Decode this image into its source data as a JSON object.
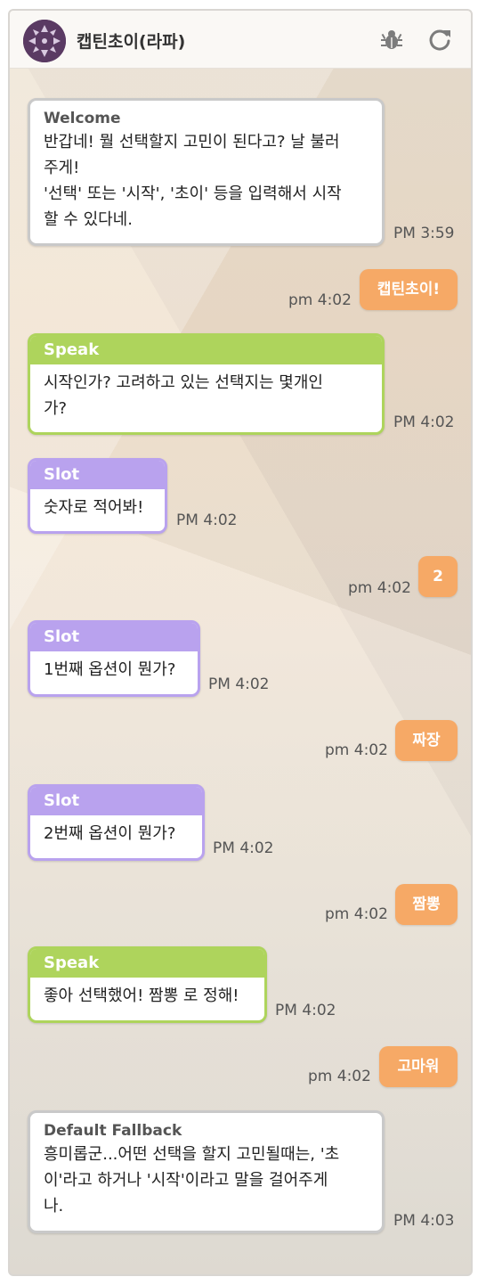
{
  "header": {
    "title": "캡틴초이(라파)",
    "icons": [
      "avatar",
      "bug-icon",
      "reload-icon"
    ]
  },
  "messages": [
    {
      "type": "bot",
      "kind": "Welcome",
      "head": "Welcome",
      "lines": [
        "반갑네! 뭘 선택할지 고민이 된다고? 날 불러",
        "주게!",
        "'선택' 또는 '시작', '초이' 등을 입력해서 시작",
        "할 수 있다네."
      ],
      "time": "PM 3:59"
    },
    {
      "type": "user",
      "text": "캡틴초이!",
      "time": "pm 4:02"
    },
    {
      "type": "bot",
      "kind": "Speak",
      "head": "Speak",
      "lines": [
        "시작인가? 고려하고 있는 선택지는 몇개인",
        "가?"
      ],
      "time": "PM 4:02"
    },
    {
      "type": "bot",
      "kind": "Slot",
      "head": "Slot",
      "lines": [
        "숫자로 적어봐!"
      ],
      "time": "PM 4:02"
    },
    {
      "type": "user",
      "text": "2",
      "time": "pm 4:02"
    },
    {
      "type": "bot",
      "kind": "Slot",
      "head": "Slot",
      "lines": [
        "1번째 옵션이 뭔가?"
      ],
      "time": "PM 4:02"
    },
    {
      "type": "user",
      "text": "짜장",
      "time": "pm 4:02"
    },
    {
      "type": "bot",
      "kind": "Slot",
      "head": "Slot",
      "lines": [
        "2번째 옵션이 뭔가?"
      ],
      "time": "PM 4:02"
    },
    {
      "type": "user",
      "text": "짬뽕",
      "time": "pm 4:02"
    },
    {
      "type": "bot",
      "kind": "Speak",
      "head": "Speak",
      "lines": [
        "좋아 선택했어! 짬뽕 로 정해!"
      ],
      "time": "PM 4:02"
    },
    {
      "type": "user",
      "text": "고마워",
      "time": "pm 4:02"
    },
    {
      "type": "bot",
      "kind": "Default Fallback",
      "head": "Default Fallback",
      "lines": [
        "흥미롭군...어떤 선택을 할지 고민될때는, '초",
        "이'라고 하거나 '시작'이라고 말을 걸어주게",
        "나."
      ],
      "time": "PM 4:03"
    }
  ],
  "colors": {
    "speak": "#aed45c",
    "slot": "#b9a2ee",
    "user_bubble": "#f6a966",
    "welcome_border": "#c9c9c9"
  }
}
